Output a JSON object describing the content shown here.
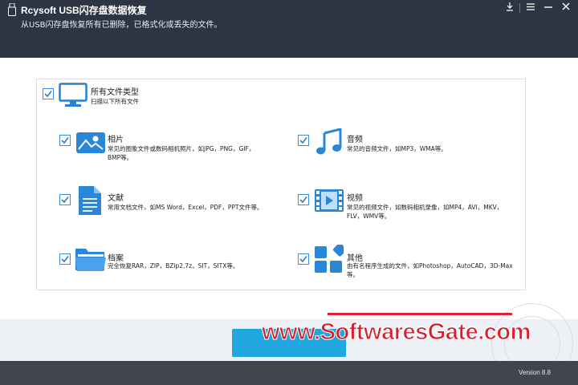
{
  "window": {
    "title": "Rcysoft USB闪存盘数据恢复",
    "subtitle": "从USB闪存盘恢复所有已删除，已格式化或丢失的文件。",
    "controls": [
      "download",
      "menu",
      "minimize",
      "close"
    ]
  },
  "all_types": {
    "title": "所有文件类型",
    "subtitle": "扫描以下所有文件",
    "checked": true
  },
  "categories": [
    {
      "title": "相片",
      "desc": [
        "常见的图象文件或数码相机照片，如JPG，PNG，GIF，",
        "BMP等。"
      ],
      "checked": true,
      "icon": "photo-icon"
    },
    {
      "title": "音频",
      "desc": [
        "常见的音频文件，如MP3，WMA等。"
      ],
      "checked": true,
      "icon": "music-note-icon"
    },
    {
      "title": "文献",
      "desc": [
        "常用文档文件，如MS Word，Excel，PDF，PPT文件等。"
      ],
      "checked": true,
      "icon": "document-icon"
    },
    {
      "title": "视频",
      "desc": [
        "常见的视频文件，如数码相机录像，如MP4，AVI，MKV，",
        "FLV，WMV等。"
      ],
      "checked": true,
      "icon": "video-icon"
    },
    {
      "title": "档案",
      "desc": [
        "完全恢复RAR，ZIP，BZip2,7z，SIT，SITX等。"
      ],
      "checked": true,
      "icon": "folder-icon"
    },
    {
      "title": "其他",
      "desc": [
        "由有名程序生成的文件，如Photoshop，AutoCAD，3D-Max",
        "等。"
      ],
      "checked": true,
      "icon": "other-apps-icon"
    }
  ],
  "version": "Version 8.8",
  "watermark": "www.SoftwaresGate.com",
  "colors": {
    "accent": "#3c8edb",
    "titlebar": "#2d3442",
    "scan_button": "#1fa8dd",
    "watermark": "#d91d2a"
  }
}
